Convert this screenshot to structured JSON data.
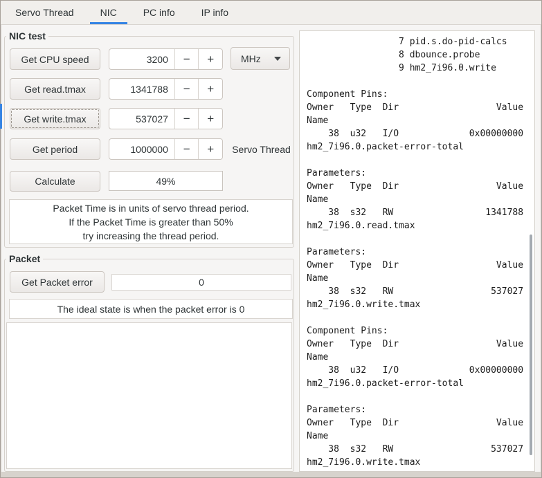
{
  "tabs": [
    {
      "label": "Servo Thread",
      "active": false
    },
    {
      "label": "NIC",
      "active": true
    },
    {
      "label": "PC info",
      "active": false
    },
    {
      "label": "IP info",
      "active": false
    }
  ],
  "nic_test": {
    "legend": "NIC test",
    "cpu_row": {
      "button": "Get CPU speed",
      "value": "3200",
      "unit": "MHz"
    },
    "read_row": {
      "button": "Get read.tmax",
      "value": "1341788"
    },
    "write_row": {
      "button": "Get write.tmax",
      "value": "537027"
    },
    "period_row": {
      "button": "Get period",
      "value": "1000000",
      "label": "Servo Thread"
    },
    "calc_row": {
      "button": "Calculate",
      "progress": "49%"
    },
    "note": [
      "Packet Time is in units of servo thread period.",
      "If the Packet Time is greater than 50%",
      "try increasing the thread period."
    ]
  },
  "packet": {
    "legend": "Packet",
    "button": "Get Packet error",
    "error_value": "0",
    "note": "The ideal state is when the packet error is 0"
  },
  "hal_output": [
    "                 7 pid.s.do-pid-calcs",
    "                 8 dbounce.probe",
    "                 9 hm2_7i96.0.write",
    "",
    "Component Pins:",
    "Owner   Type  Dir                  Value",
    "Name",
    "    38  u32   I/O             0x00000000",
    "hm2_7i96.0.packet-error-total",
    "",
    "Parameters:",
    "Owner   Type  Dir                  Value",
    "Name",
    "    38  s32   RW                 1341788",
    "hm2_7i96.0.read.tmax",
    "",
    "Parameters:",
    "Owner   Type  Dir                  Value",
    "Name",
    "    38  s32   RW                  537027",
    "hm2_7i96.0.write.tmax",
    "",
    "Component Pins:",
    "Owner   Type  Dir                  Value",
    "Name",
    "    38  u32   I/O             0x00000000",
    "hm2_7i96.0.packet-error-total",
    "",
    "Parameters:",
    "Owner   Type  Dir                  Value",
    "Name",
    "    38  s32   RW                  537027",
    "hm2_7i96.0.write.tmax"
  ],
  "icons": {
    "minus": "−",
    "plus": "+",
    "dropdown_arrow": "▼"
  },
  "colors": {
    "accent": "#3584e4"
  }
}
